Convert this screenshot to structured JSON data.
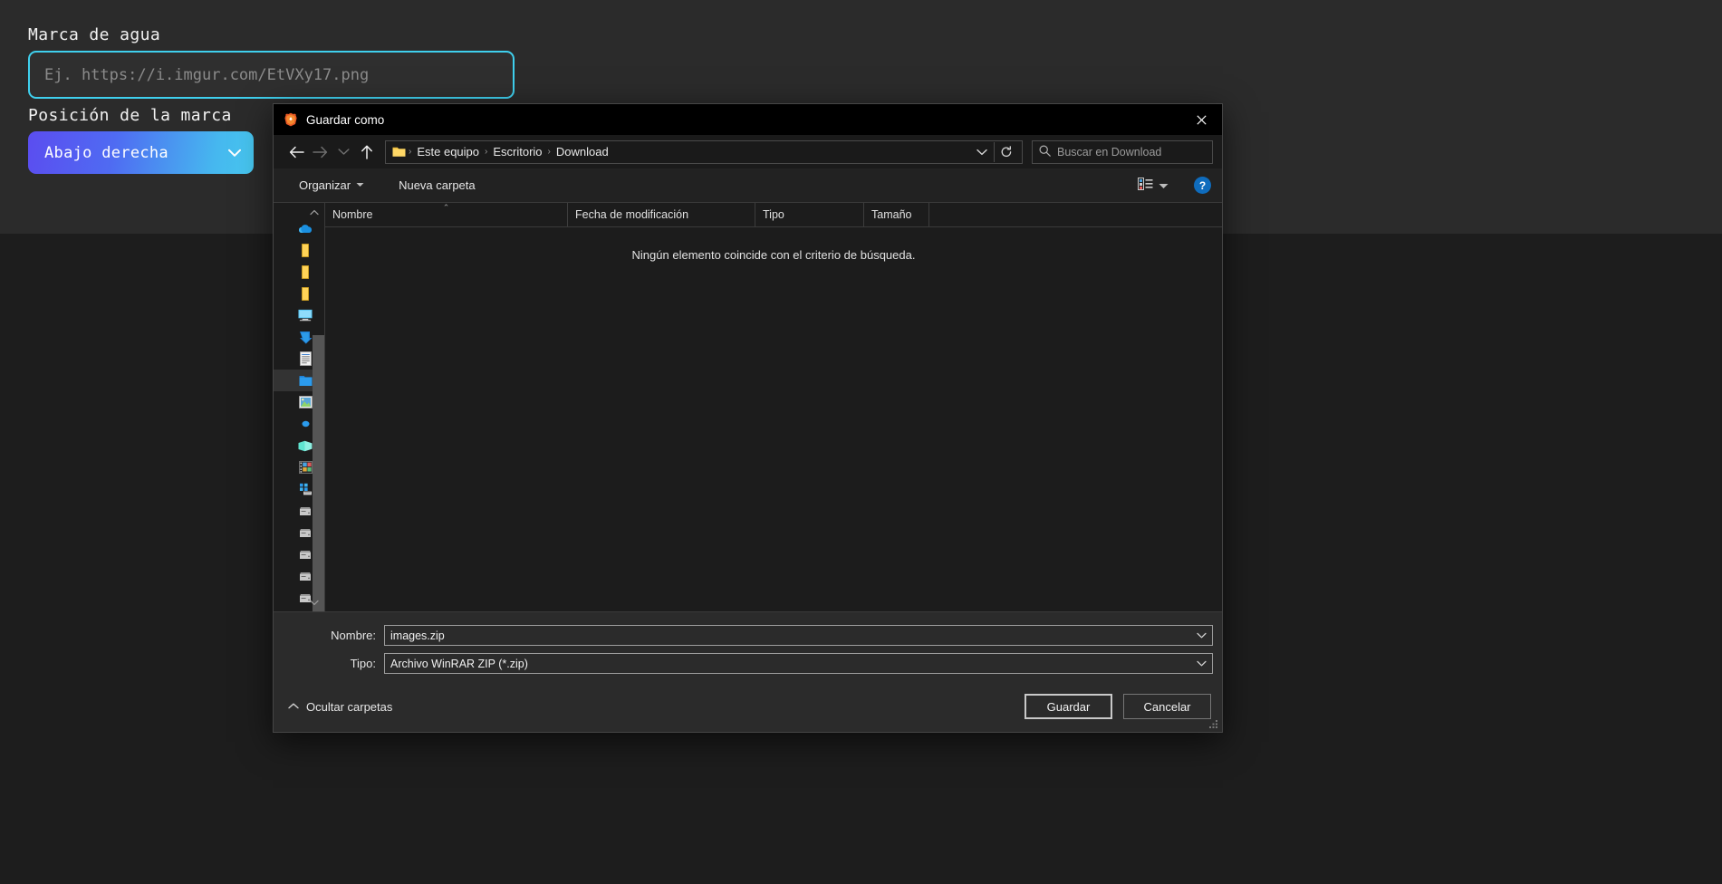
{
  "app": {
    "watermark_label": "Marca de agua",
    "watermark_placeholder": "Ej. https://i.imgur.com/EtVXy17.png",
    "watermark_value": "",
    "position_label": "Posición de la marca",
    "position_value": "Abajo derecha",
    "accent_input_border": "#3fd0ee",
    "select_gradient_from": "#5b4df0",
    "select_gradient_to": "#47c8f0",
    "panel_bg": "#2b2b2b",
    "page_bg": "#1d1d1d"
  },
  "dialog": {
    "title": "Guardar como",
    "app_icon": "brave-lion-icon",
    "close_label": "✕",
    "nav": {
      "back": "←",
      "forward": "→",
      "recent": "⌄",
      "up": "↑"
    },
    "breadcrumb": {
      "items": [
        "Este equipo",
        "Escritorio",
        "Download"
      ],
      "separator": "›"
    },
    "address_actions": {
      "dropdown": "⌄",
      "refresh": "↻"
    },
    "search": {
      "placeholder": "Buscar en Download",
      "value": ""
    },
    "commandbar": {
      "organize": "Organizar",
      "new_folder": "Nueva carpeta",
      "view_mode": "view-mode-icon",
      "help": "?"
    },
    "columns": [
      {
        "label": "Nombre",
        "sorted": true,
        "sort_glyph": "⌃"
      },
      {
        "label": "Fecha de modificación",
        "sorted": false,
        "sort_glyph": ""
      },
      {
        "label": "Tipo",
        "sorted": false,
        "sort_glyph": ""
      },
      {
        "label": "Tamaño",
        "sorted": false,
        "sort_glyph": ""
      }
    ],
    "empty_message": "Ningún elemento coincide con el criterio de búsqueda.",
    "sidebar_items": [
      {
        "icon": "onedrive-cloud-icon",
        "selected": false
      },
      {
        "icon": "folder-yellow-icon",
        "selected": false
      },
      {
        "icon": "folder-yellow-icon",
        "selected": false
      },
      {
        "icon": "folder-yellow-icon",
        "selected": false
      },
      {
        "icon": "this-pc-monitor-icon",
        "selected": false
      },
      {
        "icon": "downloads-arrow-icon",
        "selected": false
      },
      {
        "icon": "documents-icon",
        "selected": false
      },
      {
        "icon": "desktop-folder-icon",
        "selected": true
      },
      {
        "icon": "pictures-icon",
        "selected": false
      },
      {
        "icon": "small-blue-dot-icon",
        "selected": false
      },
      {
        "icon": "music-teal-icon",
        "selected": false
      },
      {
        "icon": "videos-film-icon",
        "selected": false
      },
      {
        "icon": "network-apps-icon",
        "selected": false
      },
      {
        "icon": "drive-icon",
        "selected": false
      },
      {
        "icon": "drive-icon",
        "selected": false
      },
      {
        "icon": "drive-icon",
        "selected": false
      },
      {
        "icon": "drive-icon",
        "selected": false
      },
      {
        "icon": "drive-icon",
        "selected": false
      },
      {
        "icon": "network-cloud-icon",
        "selected": false
      }
    ],
    "form": {
      "name_label": "Nombre:",
      "name_value": "images.zip",
      "type_label": "Tipo:",
      "type_value": "Archivo WinRAR ZIP (*.zip)"
    },
    "footer": {
      "hide_folders": "Ocultar carpetas",
      "hide_folders_chevron": "⌃",
      "save": "Guardar",
      "cancel": "Cancelar"
    }
  }
}
